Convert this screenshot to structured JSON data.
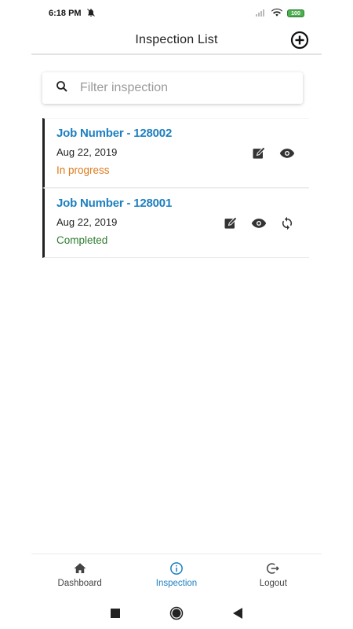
{
  "status_bar": {
    "time": "6:18 PM",
    "battery": "100"
  },
  "app_bar": {
    "title": "Inspection List"
  },
  "search": {
    "placeholder": "Filter inspection",
    "value": ""
  },
  "inspections": [
    {
      "title": "Job Number - 128002",
      "date": "Aug 22, 2019",
      "status": "In progress",
      "status_color": "#e07a1d"
    },
    {
      "title": "Job Number - 128001",
      "date": "Aug 22, 2019",
      "status": "Completed",
      "status_color": "#2e7d32"
    }
  ],
  "bottom_nav": {
    "items": [
      {
        "label": "Dashboard",
        "icon": "home-icon"
      },
      {
        "label": "Inspection",
        "icon": "info-icon"
      },
      {
        "label": "Logout",
        "icon": "logout-icon"
      }
    ],
    "active": "Inspection"
  },
  "colors": {
    "accent": "#1c7fc0",
    "in_progress": "#e07a1d",
    "completed": "#2e7d32"
  }
}
